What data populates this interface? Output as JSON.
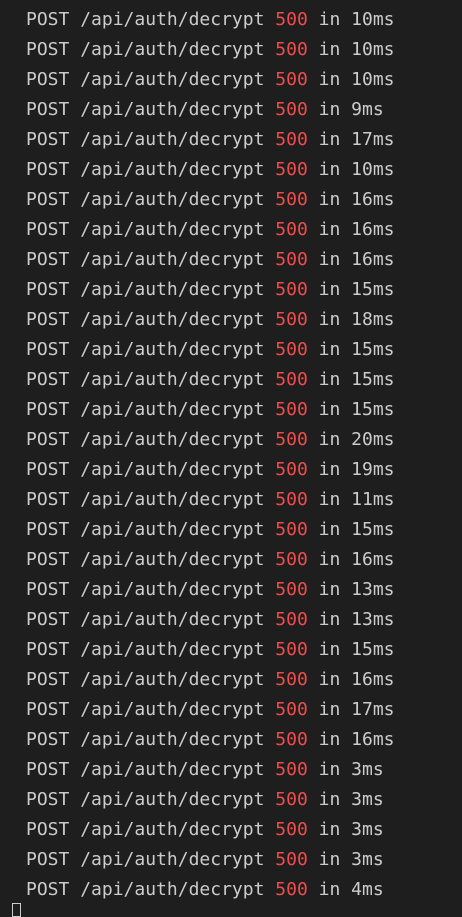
{
  "theme": {
    "background": "#1e1e1e",
    "text": "#cccccc",
    "status_error": "#f14c4c"
  },
  "log": [
    {
      "method": "POST",
      "path": "/api/auth/decrypt",
      "status": "500",
      "in": "in",
      "duration": "10ms"
    },
    {
      "method": "POST",
      "path": "/api/auth/decrypt",
      "status": "500",
      "in": "in",
      "duration": "10ms"
    },
    {
      "method": "POST",
      "path": "/api/auth/decrypt",
      "status": "500",
      "in": "in",
      "duration": "10ms"
    },
    {
      "method": "POST",
      "path": "/api/auth/decrypt",
      "status": "500",
      "in": "in",
      "duration": "9ms"
    },
    {
      "method": "POST",
      "path": "/api/auth/decrypt",
      "status": "500",
      "in": "in",
      "duration": "17ms"
    },
    {
      "method": "POST",
      "path": "/api/auth/decrypt",
      "status": "500",
      "in": "in",
      "duration": "10ms"
    },
    {
      "method": "POST",
      "path": "/api/auth/decrypt",
      "status": "500",
      "in": "in",
      "duration": "16ms"
    },
    {
      "method": "POST",
      "path": "/api/auth/decrypt",
      "status": "500",
      "in": "in",
      "duration": "16ms"
    },
    {
      "method": "POST",
      "path": "/api/auth/decrypt",
      "status": "500",
      "in": "in",
      "duration": "16ms"
    },
    {
      "method": "POST",
      "path": "/api/auth/decrypt",
      "status": "500",
      "in": "in",
      "duration": "15ms"
    },
    {
      "method": "POST",
      "path": "/api/auth/decrypt",
      "status": "500",
      "in": "in",
      "duration": "18ms"
    },
    {
      "method": "POST",
      "path": "/api/auth/decrypt",
      "status": "500",
      "in": "in",
      "duration": "15ms"
    },
    {
      "method": "POST",
      "path": "/api/auth/decrypt",
      "status": "500",
      "in": "in",
      "duration": "15ms"
    },
    {
      "method": "POST",
      "path": "/api/auth/decrypt",
      "status": "500",
      "in": "in",
      "duration": "15ms"
    },
    {
      "method": "POST",
      "path": "/api/auth/decrypt",
      "status": "500",
      "in": "in",
      "duration": "20ms"
    },
    {
      "method": "POST",
      "path": "/api/auth/decrypt",
      "status": "500",
      "in": "in",
      "duration": "19ms"
    },
    {
      "method": "POST",
      "path": "/api/auth/decrypt",
      "status": "500",
      "in": "in",
      "duration": "11ms"
    },
    {
      "method": "POST",
      "path": "/api/auth/decrypt",
      "status": "500",
      "in": "in",
      "duration": "15ms"
    },
    {
      "method": "POST",
      "path": "/api/auth/decrypt",
      "status": "500",
      "in": "in",
      "duration": "16ms"
    },
    {
      "method": "POST",
      "path": "/api/auth/decrypt",
      "status": "500",
      "in": "in",
      "duration": "13ms"
    },
    {
      "method": "POST",
      "path": "/api/auth/decrypt",
      "status": "500",
      "in": "in",
      "duration": "13ms"
    },
    {
      "method": "POST",
      "path": "/api/auth/decrypt",
      "status": "500",
      "in": "in",
      "duration": "15ms"
    },
    {
      "method": "POST",
      "path": "/api/auth/decrypt",
      "status": "500",
      "in": "in",
      "duration": "16ms"
    },
    {
      "method": "POST",
      "path": "/api/auth/decrypt",
      "status": "500",
      "in": "in",
      "duration": "17ms"
    },
    {
      "method": "POST",
      "path": "/api/auth/decrypt",
      "status": "500",
      "in": "in",
      "duration": "16ms"
    },
    {
      "method": "POST",
      "path": "/api/auth/decrypt",
      "status": "500",
      "in": "in",
      "duration": "3ms"
    },
    {
      "method": "POST",
      "path": "/api/auth/decrypt",
      "status": "500",
      "in": "in",
      "duration": "3ms"
    },
    {
      "method": "POST",
      "path": "/api/auth/decrypt",
      "status": "500",
      "in": "in",
      "duration": "3ms"
    },
    {
      "method": "POST",
      "path": "/api/auth/decrypt",
      "status": "500",
      "in": "in",
      "duration": "3ms"
    },
    {
      "method": "POST",
      "path": "/api/auth/decrypt",
      "status": "500",
      "in": "in",
      "duration": "4ms"
    }
  ],
  "cursor": {
    "icon": "terminal-cursor-icon"
  }
}
